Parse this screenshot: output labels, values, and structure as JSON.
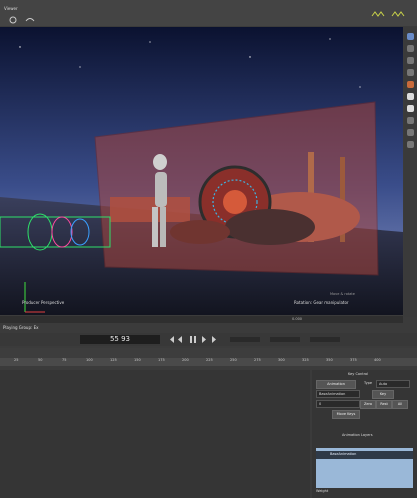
{
  "app": {
    "title": "Viewer"
  },
  "viewport": {
    "camera_label": "Producer Perspective",
    "mode_label": "Rotation: Gear manipulator",
    "top_label": "Move & rotate",
    "coord_readout": "0.000"
  },
  "panel": {
    "title": "Playing Group: Ex",
    "timecode": "55 93",
    "ruler_ticks": [
      "25",
      "50",
      "75",
      "100",
      "125",
      "150",
      "175",
      "200",
      "225",
      "250",
      "275",
      "300",
      "325",
      "350",
      "375",
      "400"
    ]
  },
  "rightpanel": {
    "title": "Key Control",
    "tab_label": "Animation",
    "type_label": "Type",
    "type_value": "Auto",
    "base_label": "BaseAnimation",
    "key_label": "Key",
    "field1": "0",
    "btn_zero": "Zero",
    "btn_rest": "Rest",
    "btn_all": "All",
    "move_label": "Move Keys",
    "layers_title": "Animation Layers",
    "layer_name": "BaseAnimation",
    "weight_label": "Weight"
  },
  "colors": {
    "accent": "#9ab8d8",
    "panel_bg": "#353535",
    "viewport_sky": "#5c6a9a"
  }
}
